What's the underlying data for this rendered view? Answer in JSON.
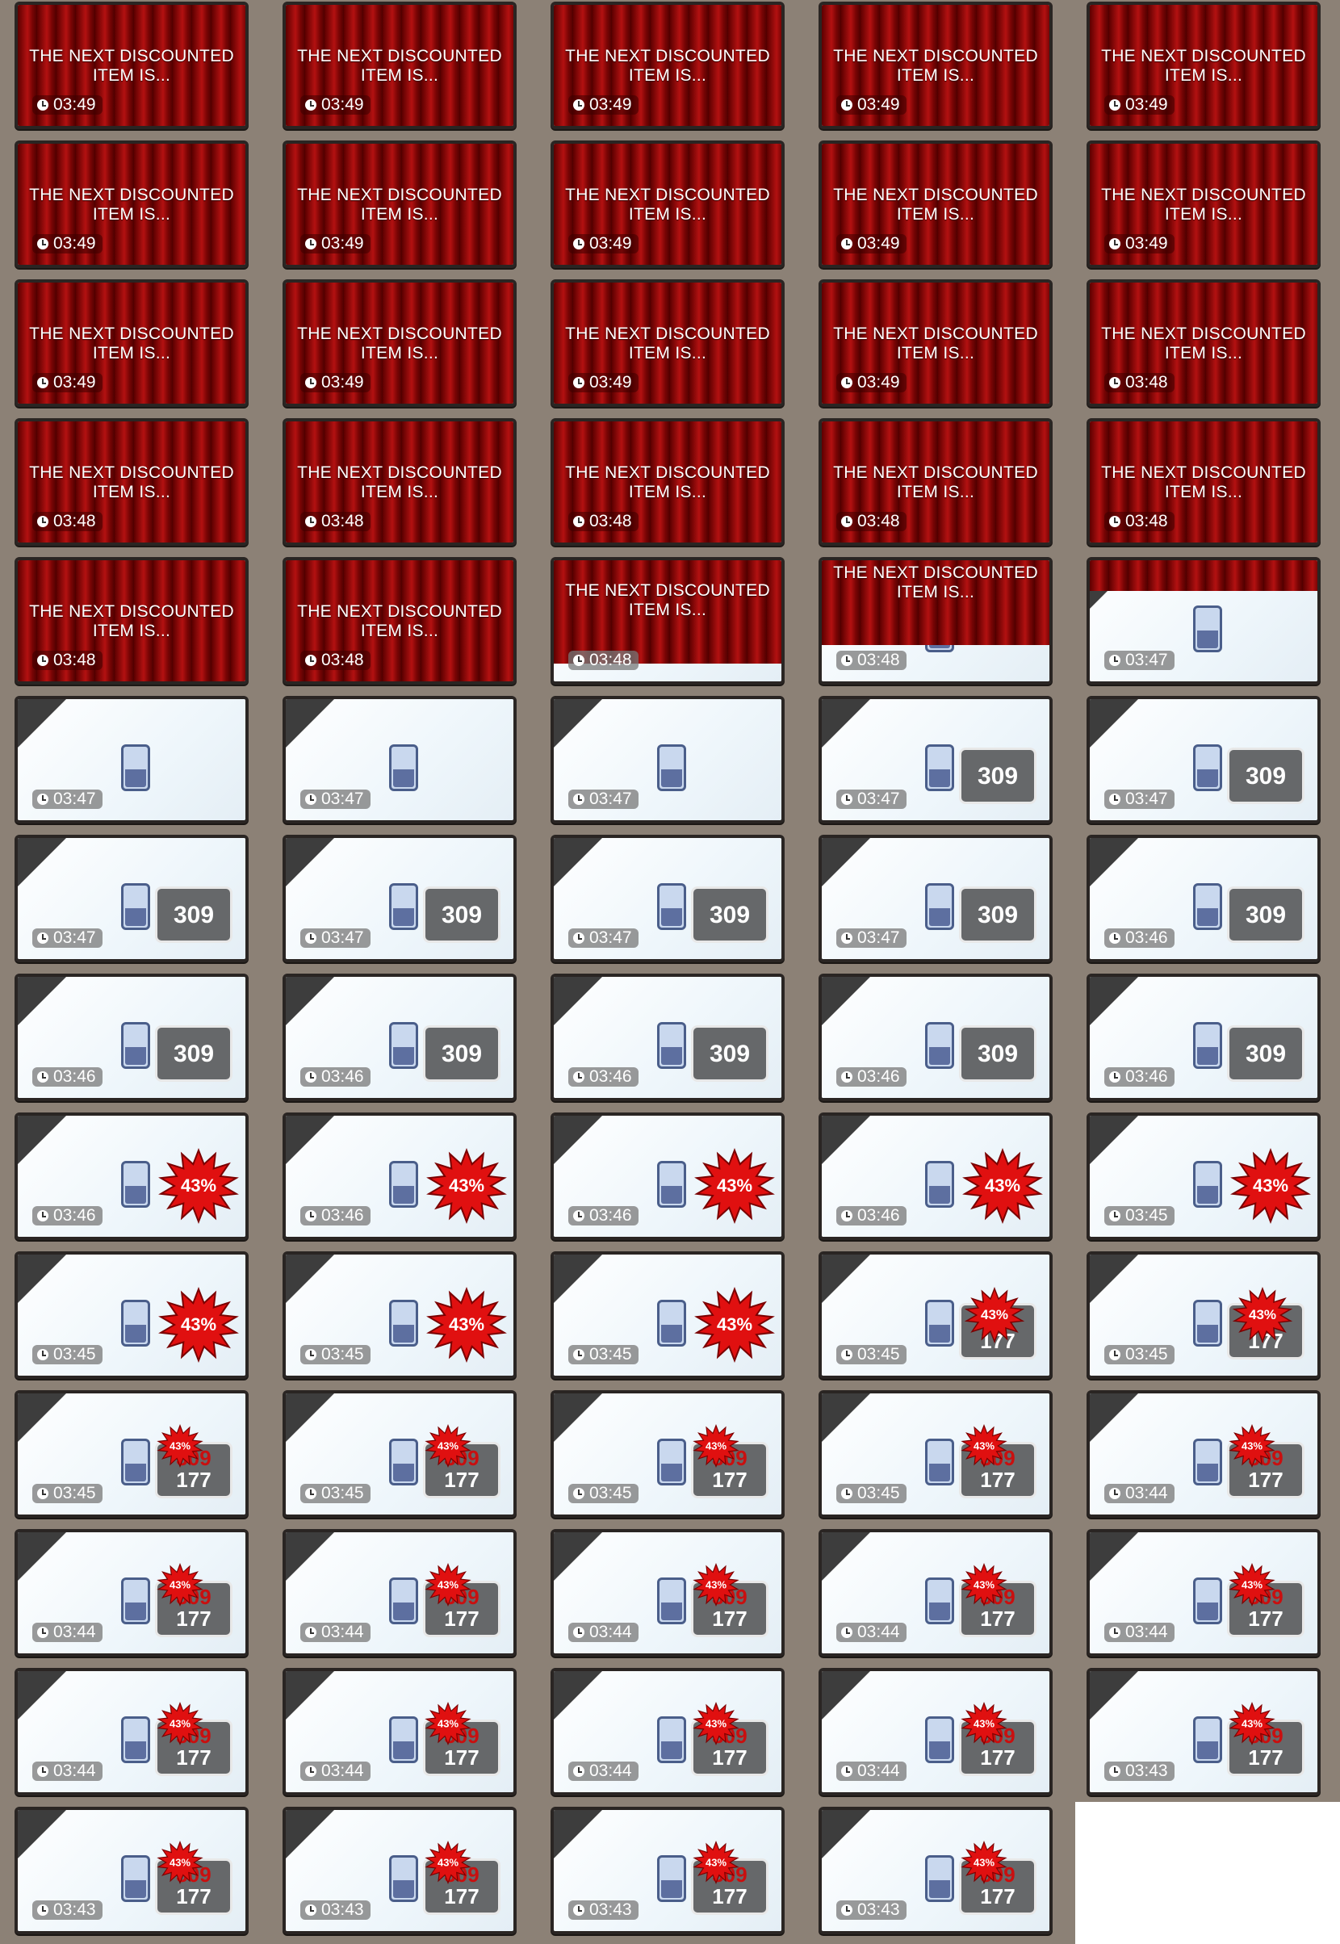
{
  "overlay_text": "THE NEXT DISCOUNTED ITEM IS...",
  "frames": [
    {
      "timer": "03:49",
      "stage": "curtain"
    },
    {
      "timer": "03:49",
      "stage": "curtain"
    },
    {
      "timer": "03:49",
      "stage": "curtain"
    },
    {
      "timer": "03:49",
      "stage": "curtain"
    },
    {
      "timer": "03:49",
      "stage": "curtain"
    },
    {
      "timer": "03:49",
      "stage": "curtain"
    },
    {
      "timer": "03:49",
      "stage": "curtain"
    },
    {
      "timer": "03:49",
      "stage": "curtain"
    },
    {
      "timer": "03:49",
      "stage": "curtain"
    },
    {
      "timer": "03:49",
      "stage": "curtain"
    },
    {
      "timer": "03:49",
      "stage": "curtain"
    },
    {
      "timer": "03:49",
      "stage": "curtain"
    },
    {
      "timer": "03:49",
      "stage": "curtain"
    },
    {
      "timer": "03:49",
      "stage": "curtain"
    },
    {
      "timer": "03:48",
      "stage": "curtain"
    },
    {
      "timer": "03:48",
      "stage": "curtain"
    },
    {
      "timer": "03:48",
      "stage": "curtain"
    },
    {
      "timer": "03:48",
      "stage": "curtain"
    },
    {
      "timer": "03:48",
      "stage": "curtain"
    },
    {
      "timer": "03:48",
      "stage": "curtain"
    },
    {
      "timer": "03:48",
      "stage": "curtain"
    },
    {
      "timer": "03:48",
      "stage": "curtain"
    },
    {
      "timer": "03:48",
      "stage": "curtain-rising",
      "curtain_fraction": 0.85
    },
    {
      "timer": "03:48",
      "stage": "curtain-rising",
      "curtain_fraction": 0.7
    },
    {
      "timer": "03:47",
      "stage": "curtain-rising",
      "curtain_fraction": 0.25
    },
    {
      "timer": "03:47",
      "stage": "product"
    },
    {
      "timer": "03:47",
      "stage": "product"
    },
    {
      "timer": "03:47",
      "stage": "product"
    },
    {
      "timer": "03:47",
      "stage": "price",
      "price": "309"
    },
    {
      "timer": "03:47",
      "stage": "price",
      "price": "309"
    },
    {
      "timer": "03:47",
      "stage": "price",
      "price": "309"
    },
    {
      "timer": "03:47",
      "stage": "price",
      "price": "309"
    },
    {
      "timer": "03:47",
      "stage": "price",
      "price": "309"
    },
    {
      "timer": "03:47",
      "stage": "price",
      "price": "309"
    },
    {
      "timer": "03:46",
      "stage": "price",
      "price": "309"
    },
    {
      "timer": "03:46",
      "stage": "price",
      "price": "309"
    },
    {
      "timer": "03:46",
      "stage": "price",
      "price": "309"
    },
    {
      "timer": "03:46",
      "stage": "price",
      "price": "309"
    },
    {
      "timer": "03:46",
      "stage": "price",
      "price": "309"
    },
    {
      "timer": "03:46",
      "stage": "price",
      "price": "309"
    },
    {
      "timer": "03:46",
      "stage": "burst",
      "discount": "43%"
    },
    {
      "timer": "03:46",
      "stage": "burst",
      "discount": "43%"
    },
    {
      "timer": "03:46",
      "stage": "burst",
      "discount": "43%"
    },
    {
      "timer": "03:46",
      "stage": "burst",
      "discount": "43%"
    },
    {
      "timer": "03:45",
      "stage": "burst",
      "discount": "43%"
    },
    {
      "timer": "03:45",
      "stage": "burst",
      "discount": "43%"
    },
    {
      "timer": "03:45",
      "stage": "burst",
      "discount": "43%"
    },
    {
      "timer": "03:45",
      "stage": "burst",
      "discount": "43%"
    },
    {
      "timer": "03:45",
      "stage": "burst-shrink",
      "discount": "43%",
      "price": "177"
    },
    {
      "timer": "03:45",
      "stage": "burst-shrink",
      "discount": "43%",
      "price": "177"
    },
    {
      "timer": "03:45",
      "stage": "final",
      "discount": "43%",
      "old_price": "309",
      "new_price": "177"
    },
    {
      "timer": "03:45",
      "stage": "final",
      "discount": "43%",
      "old_price": "309",
      "new_price": "177"
    },
    {
      "timer": "03:45",
      "stage": "final",
      "discount": "43%",
      "old_price": "309",
      "new_price": "177"
    },
    {
      "timer": "03:45",
      "stage": "final",
      "discount": "43%",
      "old_price": "309",
      "new_price": "177"
    },
    {
      "timer": "03:44",
      "stage": "final",
      "discount": "43%",
      "old_price": "309",
      "new_price": "177"
    },
    {
      "timer": "03:44",
      "stage": "final",
      "discount": "43%",
      "old_price": "309",
      "new_price": "177"
    },
    {
      "timer": "03:44",
      "stage": "final",
      "discount": "43%",
      "old_price": "309",
      "new_price": "177"
    },
    {
      "timer": "03:44",
      "stage": "final",
      "discount": "43%",
      "old_price": "309",
      "new_price": "177"
    },
    {
      "timer": "03:44",
      "stage": "final",
      "discount": "43%",
      "old_price": "309",
      "new_price": "177"
    },
    {
      "timer": "03:44",
      "stage": "final",
      "discount": "43%",
      "old_price": "309",
      "new_price": "177"
    },
    {
      "timer": "03:44",
      "stage": "final",
      "discount": "43%",
      "old_price": "309",
      "new_price": "177"
    },
    {
      "timer": "03:44",
      "stage": "final",
      "discount": "43%",
      "old_price": "309",
      "new_price": "177"
    },
    {
      "timer": "03:44",
      "stage": "final",
      "discount": "43%",
      "old_price": "309",
      "new_price": "177"
    },
    {
      "timer": "03:44",
      "stage": "final",
      "discount": "43%",
      "old_price": "309",
      "new_price": "177"
    },
    {
      "timer": "03:43",
      "stage": "final",
      "discount": "43%",
      "old_price": "309",
      "new_price": "177"
    },
    {
      "timer": "03:43",
      "stage": "final",
      "discount": "43%",
      "old_price": "309",
      "new_price": "177"
    },
    {
      "timer": "03:43",
      "stage": "final",
      "discount": "43%",
      "old_price": "309",
      "new_price": "177"
    },
    {
      "timer": "03:43",
      "stage": "final",
      "discount": "43%",
      "old_price": "309",
      "new_price": "177"
    },
    {
      "timer": "03:43",
      "stage": "final",
      "discount": "43%",
      "old_price": "309",
      "new_price": "177"
    }
  ],
  "icons": {
    "timer": "clock-icon",
    "product": "water-bottle-icon",
    "discount": "starburst-badge-icon"
  },
  "colors": {
    "curtain": "#8f0a0a",
    "price_box": "#66686a",
    "old_price": "#c90f0f",
    "burst": "#e01010",
    "panel": "#eef4f8"
  }
}
